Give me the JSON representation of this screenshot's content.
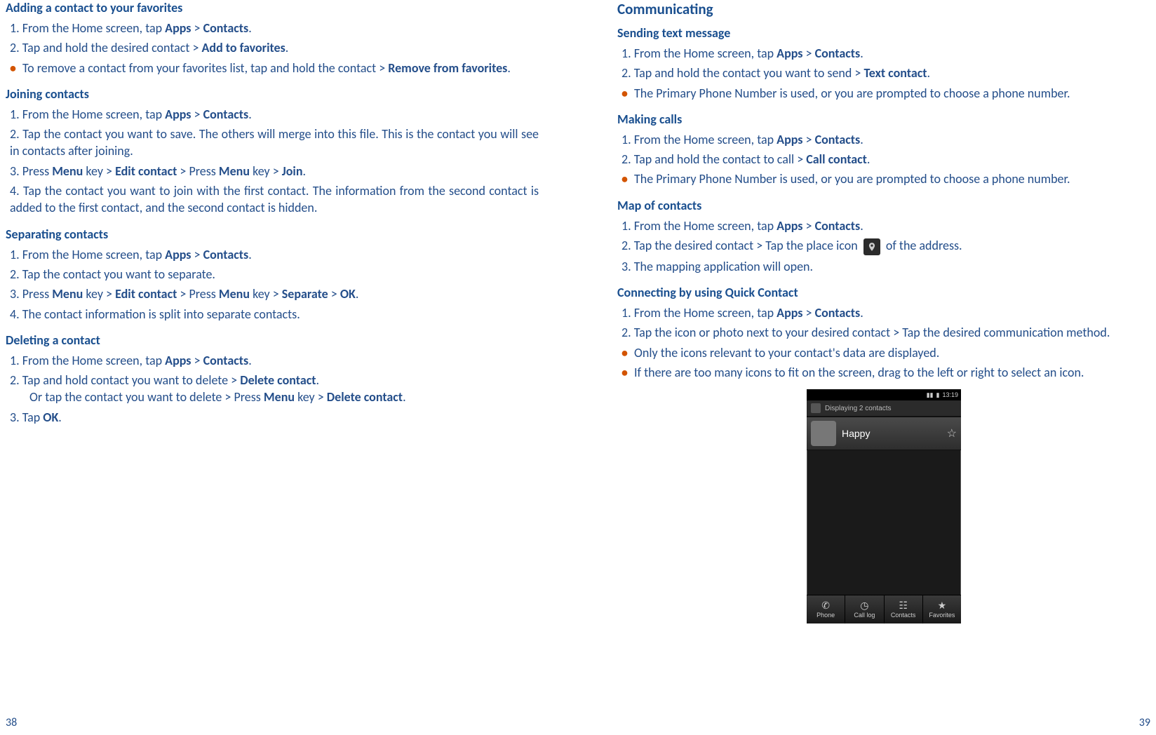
{
  "left": {
    "title": "Adding a contact to your favorites",
    "fav_s1_a": "1. ",
    "fav_s1_b": "From the Home screen, tap ",
    "fav_s1_c": "Apps",
    "fav_s1_d": " > ",
    "fav_s1_e": "Contacts",
    "fav_s1_f": ".",
    "fav_s2_a": "2. ",
    "fav_s2_b": "Tap and hold the desired contact > ",
    "fav_s2_c": "Add to favorites",
    "fav_s2_d": ".",
    "fav_b1_a": "To remove a contact from your favorites list, tap and hold the contact > ",
    "fav_b1_b": "Remove from favorites",
    "fav_b1_c": ".",
    "join_title": "Joining contacts",
    "join_s1_a": "1. ",
    "join_s1_b": "From the Home screen, tap ",
    "join_s1_c": "Apps",
    "join_s1_d": " > ",
    "join_s1_e": "Contacts",
    "join_s1_f": ".",
    "join_s2_a": "2. ",
    "join_s2_b": "Tap the contact you want to save. The others will merge into this file. This is the contact you will see in contacts after joining.",
    "join_s3_a": "3. ",
    "join_s3_b": "Press ",
    "join_s3_c": "Menu",
    "join_s3_d": " key > ",
    "join_s3_e": "Edit contact",
    "join_s3_f": " > Press ",
    "join_s3_g": "Menu",
    "join_s3_h": " key > ",
    "join_s3_i": "Join",
    "join_s3_j": ".",
    "join_s4_a": "4. ",
    "join_s4_b": "Tap the contact you want to join with the first contact. The information from the second contact is added to the first contact, and the second contact is hidden.",
    "sep_title": "Separating contacts",
    "sep_s1_a": "1. ",
    "sep_s1_b": "From the Home screen, tap ",
    "sep_s1_c": "Apps",
    "sep_s1_d": " > ",
    "sep_s1_e": "Contacts",
    "sep_s1_f": ".",
    "sep_s2_a": "2. ",
    "sep_s2_b": "Tap the contact you want to separate.",
    "sep_s3_a": "3. ",
    "sep_s3_b": "Press ",
    "sep_s3_c": "Menu",
    "sep_s3_d": " key > ",
    "sep_s3_e": "Edit contact",
    "sep_s3_f": " > Press ",
    "sep_s3_g": "Menu",
    "sep_s3_h": " key > ",
    "sep_s3_i": "Separate",
    "sep_s3_j": " > ",
    "sep_s3_k": "OK",
    "sep_s3_l": ".",
    "sep_s4_a": "4. ",
    "sep_s4_b": "The contact information is split into separate contacts.",
    "del_title": "Deleting a contact",
    "del_s1_a": "1. ",
    "del_s1_b": "From the Home screen, tap ",
    "del_s1_c": "Apps",
    "del_s1_d": " > ",
    "del_s1_e": "Contacts",
    "del_s1_f": ".",
    "del_s2_a": "2. ",
    "del_s2_b": "Tap and hold contact you want to delete > ",
    "del_s2_c": "Delete contact",
    "del_s2_d": ".",
    "del_s2_e": "Or tap the contact you want to delete > Press ",
    "del_s2_f": "Menu",
    "del_s2_g": " key > ",
    "del_s2_h": "Delete contact",
    "del_s2_i": ".",
    "del_s3_a": "3. ",
    "del_s3_b": "Tap ",
    "del_s3_c": "OK",
    "del_s3_d": ".",
    "pagenum": "38"
  },
  "right": {
    "title": "Communicating",
    "txt_title": "Sending text message",
    "txt_s1_a": "1. ",
    "txt_s1_b": "From the Home screen, tap ",
    "txt_s1_c": "Apps",
    "txt_s1_d": " > ",
    "txt_s1_e": "Contacts",
    "txt_s1_f": ".",
    "txt_s2_a": "2. ",
    "txt_s2_b": "Tap and hold the contact you want to send > ",
    "txt_s2_c": "Text contact",
    "txt_s2_d": ".",
    "txt_b1": "The Primary Phone Number is used, or you are prompted to choose a phone number.",
    "call_title": "Making calls",
    "call_s1_a": "1. ",
    "call_s1_b": "From the Home screen, tap ",
    "call_s1_c": "Apps",
    "call_s1_d": " > ",
    "call_s1_e": "Contacts",
    "call_s1_f": ".",
    "call_s2_a": "2. ",
    "call_s2_b": "Tap and hold the contact to call > ",
    "call_s2_c": "Call contact",
    "call_s2_d": ".",
    "call_b1": "The Primary Phone Number is used, or you are prompted to choose a phone number.",
    "map_title": "Map of contacts",
    "map_s1_a": "1. ",
    "map_s1_b": "From the Home screen, tap ",
    "map_s1_c": "Apps",
    "map_s1_d": " > ",
    "map_s1_e": "Contacts",
    "map_s1_f": ".",
    "map_s2_a": "2. ",
    "map_s2_b": "Tap the desired contact > Tap the place icon ",
    "map_s2_c": " of the address.",
    "map_s3_a": "3. ",
    "map_s3_b": "The mapping application will open.",
    "qc_title": "Connecting by using Quick Contact",
    "qc_s1_a": "1. ",
    "qc_s1_b": "From the Home screen, tap ",
    "qc_s1_c": "Apps",
    "qc_s1_d": " > ",
    "qc_s1_e": "Contacts",
    "qc_s1_f": ".",
    "qc_s2_a": "2. ",
    "qc_s2_b": "Tap the icon or photo next to your desired contact > Tap the desired communication method.",
    "qc_b1": "Only the icons relevant to your contact's data are displayed.",
    "qc_b2": "If there are too many icons to fit on the screen, drag to the left or right to select an icon.",
    "phone": {
      "time": "13:19",
      "disp": "Displaying 2 contacts",
      "contact": "Happy",
      "tabs": [
        "Phone",
        "Call log",
        "Contacts",
        "Favorites"
      ]
    },
    "pagenum": "39"
  }
}
